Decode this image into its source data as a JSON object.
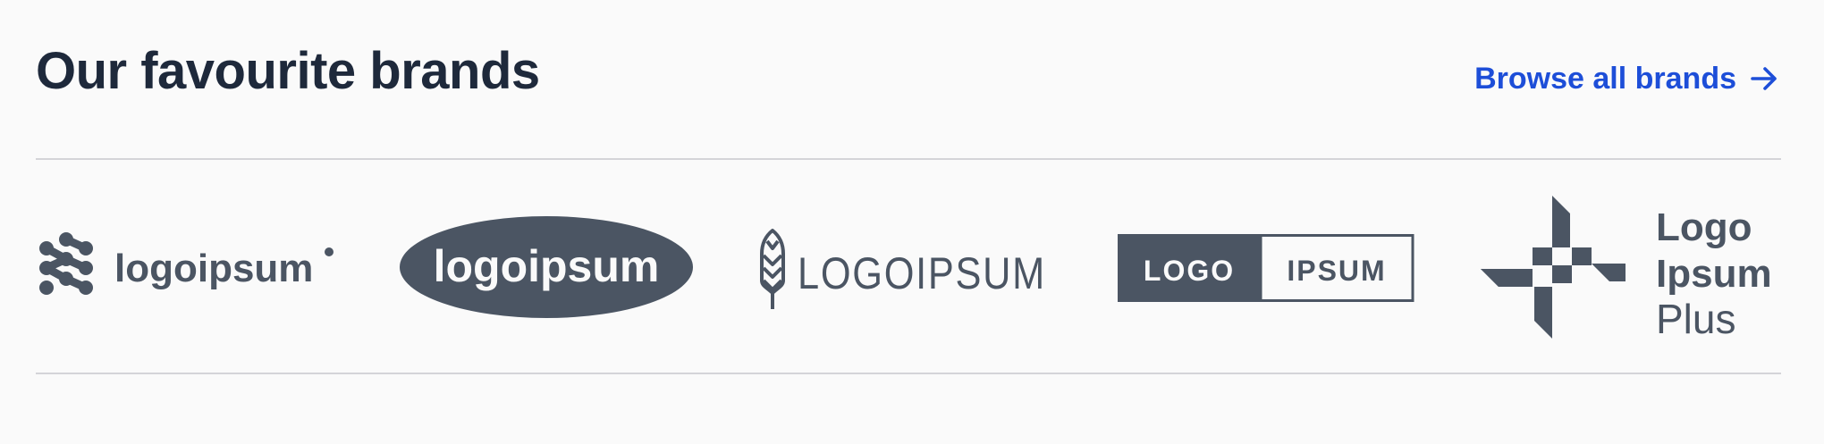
{
  "header": {
    "title": "Our favourite brands",
    "browse_label": "Browse all brands",
    "browse_icon": "arrow-right-icon"
  },
  "colors": {
    "logo": "#4b5563",
    "accent": "#1d4ed8",
    "rule": "#d4d4d8",
    "background": "#fafafa"
  },
  "brands": [
    {
      "name": "logoipsum",
      "icon": "connected-dots-icon"
    },
    {
      "name": "logoipsum",
      "icon": "ellipse-badge"
    },
    {
      "name": "LOGOIPSUM",
      "icon": "wheat-icon"
    },
    {
      "name_left": "LOGO",
      "name_right": "IPSUM",
      "icon": "split-box-badge"
    },
    {
      "line1": "Logo",
      "line2": "Ipsum",
      "line3": "Plus",
      "icon": "pinwheel-icon"
    }
  ]
}
